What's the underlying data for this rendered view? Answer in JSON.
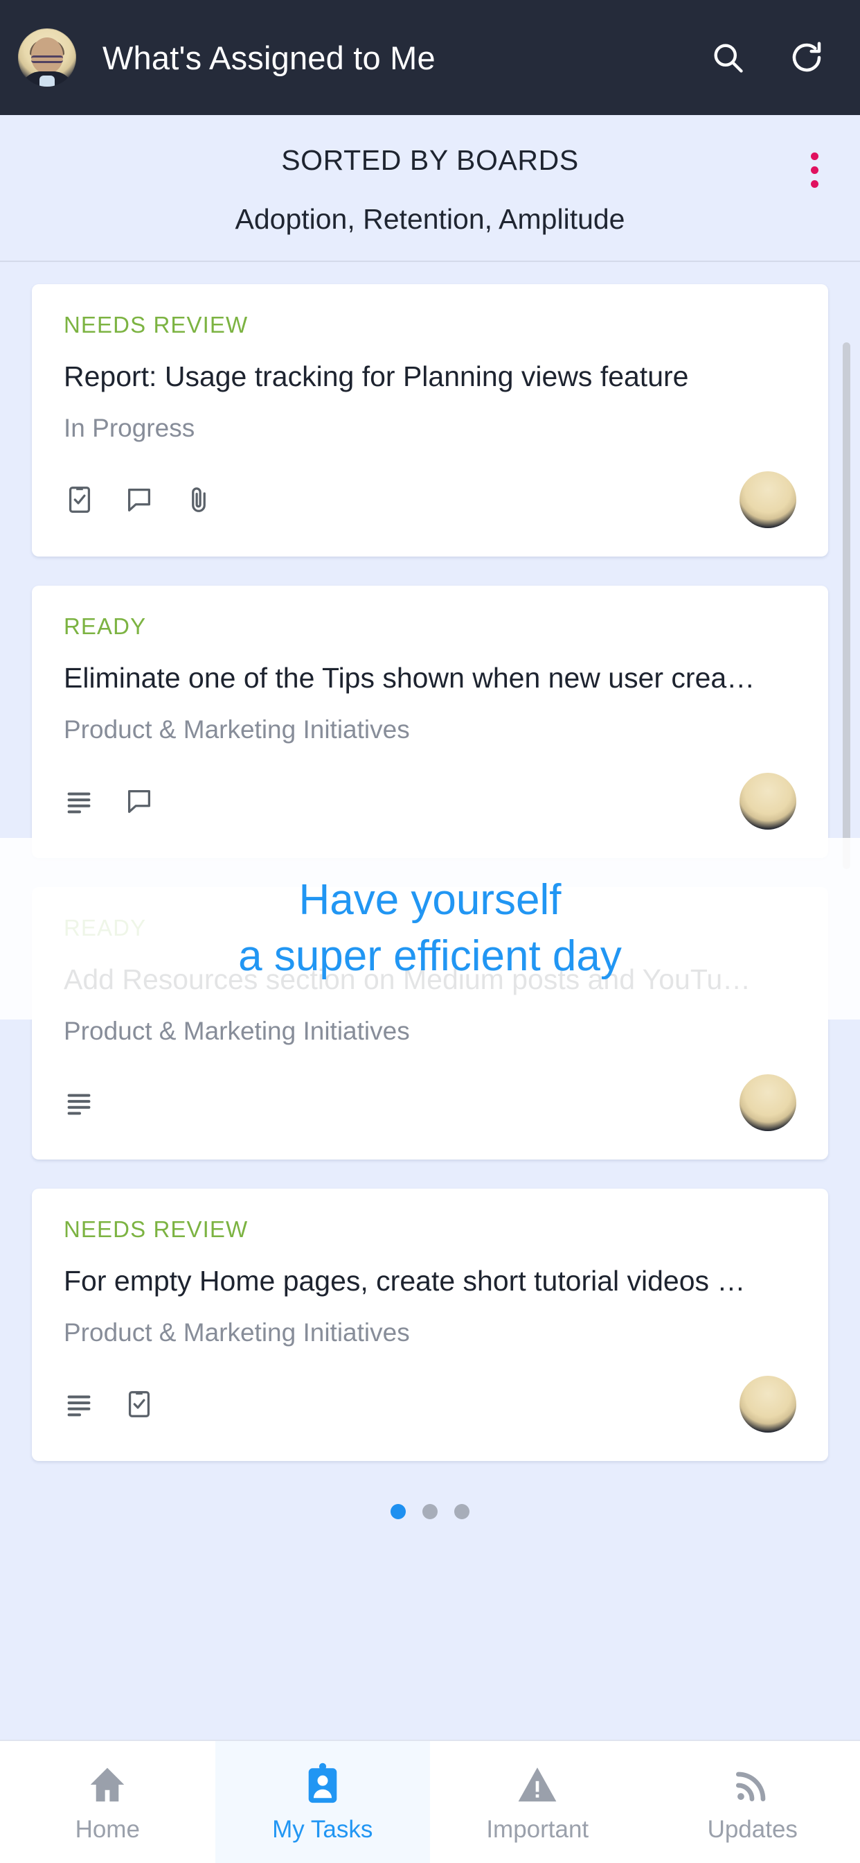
{
  "appbar": {
    "title": "What's Assigned to Me",
    "avatar_name": "user-avatar",
    "search_icon": "search-icon",
    "refresh_icon": "refresh-icon"
  },
  "sortbar": {
    "title": "SORTED BY BOARDS",
    "subtitle": "Adoption, Retention, Amplitude",
    "menu_icon": "kebab-menu-icon",
    "menu_color": "#e0115f"
  },
  "colors": {
    "appbar_bg": "#252b3a",
    "page_bg": "#e7edfd",
    "status_green": "#7cb342",
    "accent_blue": "#2196f3",
    "card_bg": "#ffffff",
    "muted_text": "#878d99"
  },
  "cards": [
    {
      "status": "NEEDS REVIEW",
      "title": "Report: Usage tracking for Planning views feature",
      "subtitle": "In Progress",
      "icons": [
        "checklist-icon",
        "comment-icon",
        "attachment-icon"
      ],
      "has_avatar": true
    },
    {
      "status": "READY",
      "title": "Eliminate one of the Tips shown when new user crea…",
      "subtitle": "Product & Marketing Initiatives",
      "icons": [
        "description-icon",
        "comment-icon"
      ],
      "has_avatar": true
    },
    {
      "status": "READY",
      "title": "Add Resources section on Medium posts and YouTu…",
      "subtitle": "Product & Marketing Initiatives",
      "icons": [
        "description-icon"
      ],
      "has_avatar": true
    },
    {
      "status": "NEEDS REVIEW",
      "title": "For empty Home pages, create short tutorial videos …",
      "subtitle": "Product & Marketing Initiatives",
      "icons": [
        "description-icon",
        "checklist-icon"
      ],
      "has_avatar": true
    }
  ],
  "overlay": {
    "line1": "Have yourself",
    "line2": "a super efficient day"
  },
  "pager": {
    "total": 3,
    "active_index": 0
  },
  "bottomnav": {
    "items": [
      {
        "label": "Home",
        "icon": "home-icon",
        "active": false
      },
      {
        "label": "My Tasks",
        "icon": "my-tasks-badge-icon",
        "active": true
      },
      {
        "label": "Important",
        "icon": "warning-triangle-icon",
        "active": false
      },
      {
        "label": "Updates",
        "icon": "rss-feed-icon",
        "active": false
      }
    ]
  }
}
